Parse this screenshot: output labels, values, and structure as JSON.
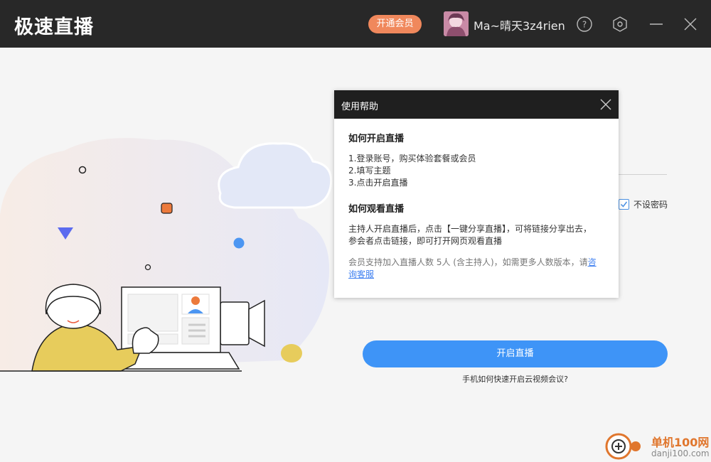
{
  "titlebar": {
    "app_title": "极速直播",
    "vip_label": "开通会员",
    "username": "Ma~晴天3z4rien",
    "icons": [
      "help-icon",
      "settings-icon",
      "minimize-icon",
      "close-icon"
    ]
  },
  "help_dialog": {
    "title": "使用帮助",
    "section1_title": "如何开启直播",
    "steps": [
      "1.登录账号，购买体验套餐或会员",
      "2.填写主题",
      "3.点击开启直播"
    ],
    "section2_title": "如何观看直播",
    "watch_text_line1": "主持人开启直播后，点击【一键分享直播】，可将链接分享出去，",
    "watch_text_line2": "参会者点击链接，即可打开网页观看直播",
    "note_text_line1": "会员支持加入直播人数 5人 (含主持人)，如需更多人数版本，请",
    "note_link_part1": "咨",
    "note_link_part2": "询客服"
  },
  "form": {
    "no_password_label": "不设密码",
    "no_password_checked": true,
    "start_button": "开启直播",
    "phone_link": "手机如何快速开启云视频会议?"
  },
  "watermark": {
    "line1": "单机100网",
    "line2": "danji100.com"
  },
  "colors": {
    "titlebar_bg": "#282828",
    "vip_orange": "#f0885c",
    "primary_blue": "#3e94f7",
    "dialog_header": "#1f1f1f"
  }
}
